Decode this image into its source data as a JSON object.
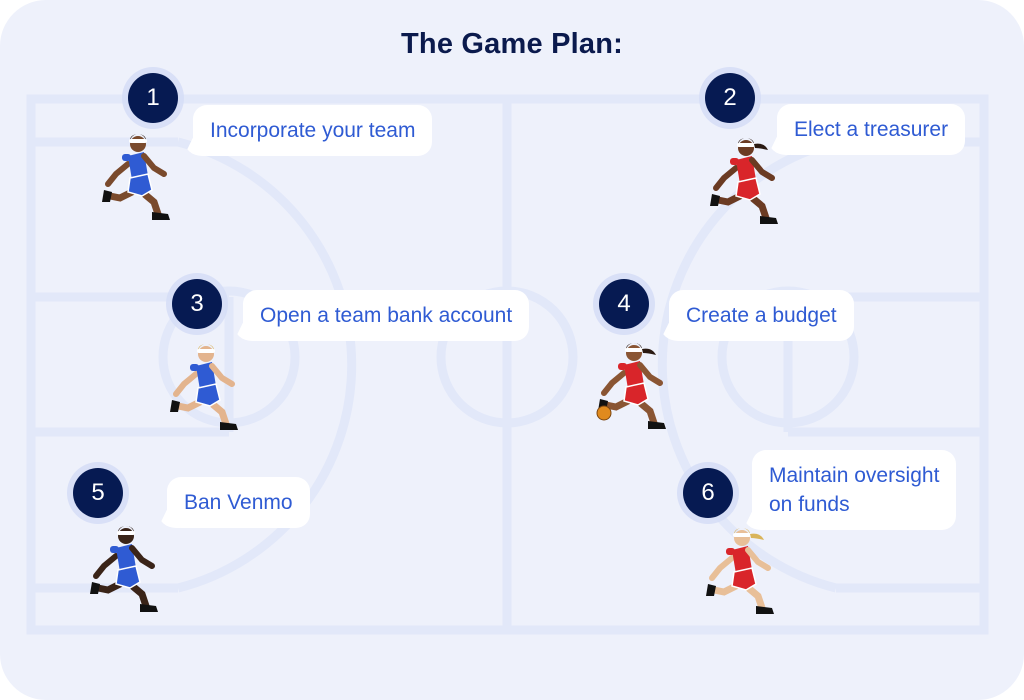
{
  "title": "The Game Plan:",
  "colors": {
    "background": "#eef1fb",
    "court_lines": "#e2e8f9",
    "badge": "#061a52",
    "bubble_text": "#2f5bd3",
    "title_text": "#0b1a4d",
    "blue_jersey": "#2f5bd3",
    "red_jersey": "#d9252a"
  },
  "steps": [
    {
      "number": "1",
      "label": "Incorporate your team",
      "player": {
        "icon": "basketball-player-blue-icon",
        "jersey": "blue",
        "skin": "#7a4a2c",
        "hair": "short-dark"
      }
    },
    {
      "number": "2",
      "label": "Elect a treasurer",
      "player": {
        "icon": "basketball-player-red-icon",
        "jersey": "red",
        "skin": "#6b3b23",
        "hair": "ponytail-dark"
      }
    },
    {
      "number": "3",
      "label": "Open a team bank account",
      "player": {
        "icon": "basketball-player-blue-icon",
        "jersey": "blue",
        "skin": "#e3b48e",
        "hair": "blond"
      }
    },
    {
      "number": "4",
      "label": "Create a budget",
      "player": {
        "icon": "basketball-player-red-dribbling-icon",
        "jersey": "red",
        "skin": "#8a5533",
        "hair": "ponytail-dark",
        "ball": true
      }
    },
    {
      "number": "5",
      "label": "Ban Venmo",
      "player": {
        "icon": "basketball-player-blue-icon",
        "jersey": "blue",
        "skin": "#3a2418",
        "hair": "short-dark"
      }
    },
    {
      "number": "6",
      "label": [
        "Maintain oversight",
        "on funds"
      ],
      "player": {
        "icon": "basketball-player-red-icon",
        "jersey": "red",
        "skin": "#e8bf98",
        "hair": "ponytail-blond"
      }
    }
  ]
}
